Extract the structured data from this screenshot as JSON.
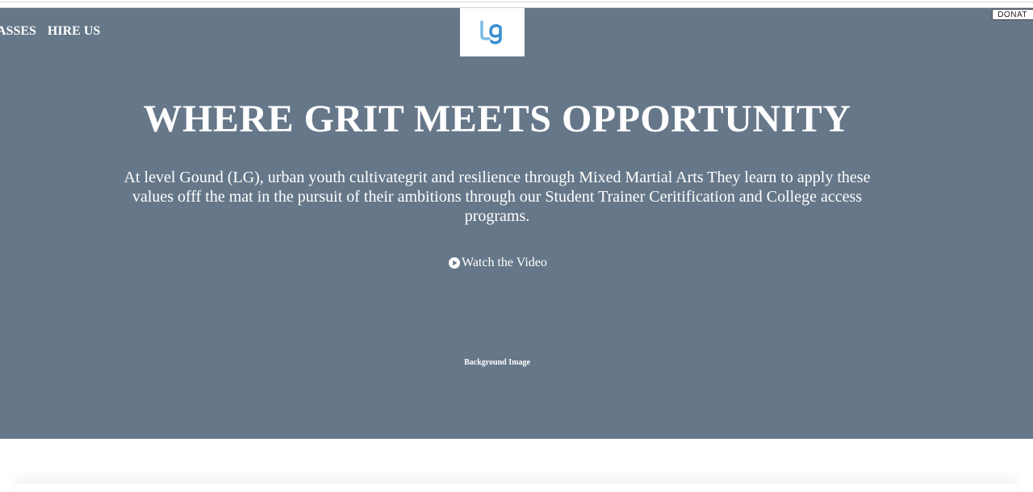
{
  "nav": {
    "items": [
      {
        "label": "ASSES"
      },
      {
        "label": "HIRE US"
      }
    ]
  },
  "logo": {
    "text": "LG",
    "colors": {
      "primary": "#3a8fd0",
      "secondary": "#7bbde8"
    }
  },
  "donate_button": {
    "label": "DONAT"
  },
  "hero": {
    "background_color": "#667789",
    "headline": "WHERE GRIT MEETS OPPORTUNITY",
    "tagline": "At level Gound (LG), urban youth cultivategrit and resilience through Mixed Martial Arts They learn to apply these values offf the mat in the pursuit of their ambitions through our Student Trainer Ceritification and College access programs.",
    "watch_video_label": "Watch the Video",
    "watch_video_icon": "play-circle-icon",
    "background_label": "Background Image"
  }
}
